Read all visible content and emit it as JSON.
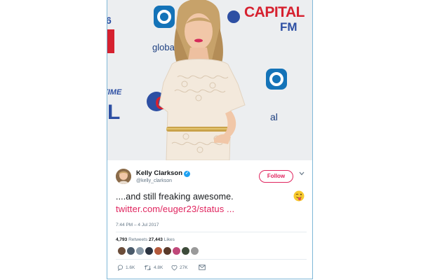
{
  "photo": {
    "alt_description": "",
    "backdrop_text": {
      "capital": "CAPITAL",
      "fm": "FM",
      "global": "global",
      "left_number": "6",
      "left_fragment": "TIME",
      "left_fragment_2": "L",
      "right_fragment": "al"
    },
    "colors": {
      "capital_red": "#d6212f",
      "capital_blue": "#2d4fa3",
      "global_blue": "#1473b8"
    }
  },
  "author": {
    "name": "Kelly Clarkson",
    "handle": "@kelly_clarkson",
    "verified_icon": "verified-badge-icon"
  },
  "header": {
    "follow_label": "Follow",
    "menu_icon": "chevron-down-icon"
  },
  "tweet": {
    "text": "....and still freaking awesome.",
    "link": "twitter.com/euger23/status ...",
    "emoji": "😜",
    "timestamp": "7:44 PM – 4 Jul 2017"
  },
  "stats": {
    "retweets_count": "4,793",
    "retweets_label": "Retweets",
    "likes_count": "27,443",
    "likes_label": "Likes"
  },
  "actions": {
    "replies": "1.6K",
    "retweets": "4.8K",
    "likes": "27K"
  },
  "colors": {
    "accent": "#e0245e",
    "verified": "#1da1f2",
    "muted": "#657786"
  }
}
